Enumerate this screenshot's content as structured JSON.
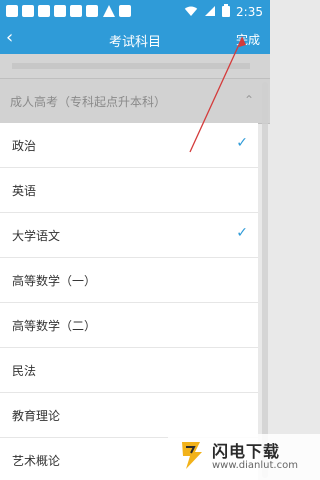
{
  "status_bar": {
    "time": "2:35"
  },
  "nav": {
    "back_icon": "‹",
    "title": "考试科目",
    "done": "完成"
  },
  "section": {
    "title": "成人高考（专科起点升本科）",
    "chevron": "⌃"
  },
  "subjects": [
    {
      "label": "政治",
      "checked": true
    },
    {
      "label": "英语",
      "checked": false
    },
    {
      "label": "大学语文",
      "checked": true
    },
    {
      "label": "高等数学（一）",
      "checked": false
    },
    {
      "label": "高等数学（二）",
      "checked": false
    },
    {
      "label": "民法",
      "checked": false
    },
    {
      "label": "教育理论",
      "checked": false
    },
    {
      "label": "艺术概论",
      "checked": false
    }
  ],
  "check_icon": "✓",
  "watermark": {
    "title": "闪电下载",
    "url": "www.dianlut.com"
  },
  "colors": {
    "primary": "#2f9bd8",
    "header_bg": "#d2d2d2",
    "annotation_arrow": "#d43b3b"
  }
}
